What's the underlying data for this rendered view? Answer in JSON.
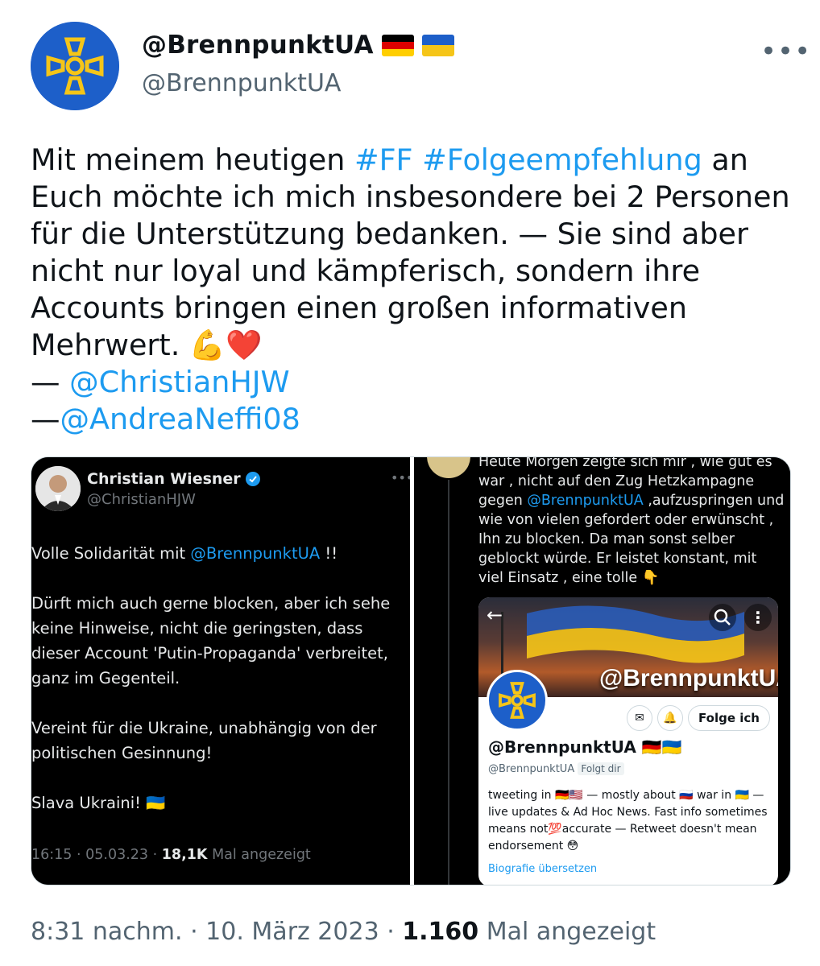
{
  "header": {
    "display_name": "@BrennpunktUA",
    "handle": "@BrennpunktUA",
    "more_label": "•••"
  },
  "tweet": {
    "line1_pre": "Mit meinem heutigen ",
    "hashtag_ff": "#FF",
    "hashtag_folge": "#Folgeempfehlung",
    "line1_post": " an Euch",
    "body": "möchte ich mich insbesondere bei 2 Personen für die Unterstützung bedanken. — Sie sind aber nicht nur loyal und kämpferisch, sondern ihre Accounts bringen einen großen informativen Mehrwert. ",
    "emoji": "💪❤️",
    "dash1": "— ",
    "mention1": "@ChristianHJW",
    "dash2": "—",
    "mention2": "@AndreaNeffi08"
  },
  "left_panel": {
    "name": "Christian Wiesner",
    "handle": "@ChristianHJW",
    "text1_pre": "Volle Solidarität mit ",
    "text1_mention": "@BrennpunktUA",
    "text1_post": " !!",
    "text2": "Dürft mich auch gerne blocken, aber ich sehe keine Hinweise, nicht die geringsten, dass dieser Account 'Putin-Propaganda' verbreitet, ganz im Gegenteil.",
    "text3": "Vereint für die Ukraine, unabhängig von der politischen Gesinnung!",
    "text4": "Slava Ukraini! 🇺🇦",
    "meta_time": "16:15 · 05.03.23 · ",
    "meta_views": "18,1K",
    "meta_label": " Mal angezeigt"
  },
  "right_panel": {
    "text_pre": "Heute Morgen zeigte sich mir , wie gut es war , nicht auf den Zug  Hetzkampagne gegen ",
    "text_mention": "@BrennpunktUA",
    "text_post": " ,aufzuspringen und wie von vielen gefordert oder erwünscht , Ihn zu blocken. Da man sonst selber geblockt würde. Er leistet konstant, mit viel Einsatz , eine tolle 👇",
    "card": {
      "banner_text": "@BrennpunktUA",
      "follow_label": "Folge ich",
      "name": "@BrennpunktUA 🇩🇪🇺🇦",
      "handle": "@BrennpunktUA",
      "follows_you": "Folgt dir",
      "bio": "tweeting in 🇩🇪🇺🇸 — mostly about 🇷🇺 war in 🇺🇦 — live updates & Ad Hoc News. Fast info sometimes means not💯accurate — Retweet doesn't mean endorsement 😳",
      "translate": "Biografie übersetzen"
    }
  },
  "footer": {
    "time": "8:31 nachm. · 10. März 2023 · ",
    "views": "1.160",
    "views_label": " Mal angezeigt"
  },
  "colors": {
    "link": "#1d9bf0",
    "ukraine_blue": "#1d5fc9",
    "ukraine_yellow": "#f5c518"
  }
}
